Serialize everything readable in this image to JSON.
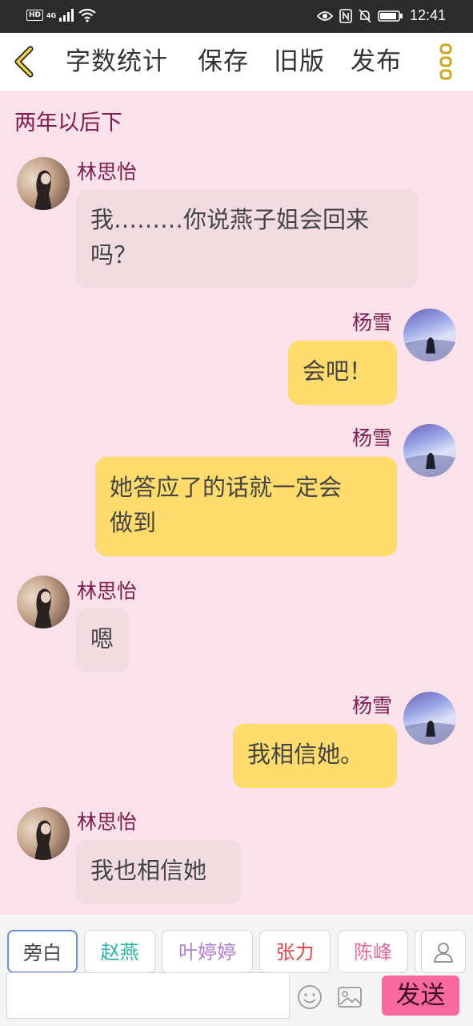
{
  "status_bar": {
    "network_badge": "HD",
    "network_type": "4G",
    "time": "12:41"
  },
  "nav": {
    "items": [
      "字数统计",
      "保存",
      "旧版",
      "发布"
    ]
  },
  "chat": {
    "narration": "两年以后下",
    "messages": [
      {
        "speaker": "林思怡",
        "side": "left",
        "text": "我………你说燕子姐会回来\n吗？"
      },
      {
        "speaker": "杨雪",
        "side": "right",
        "text": "会吧！"
      },
      {
        "speaker": "杨雪",
        "side": "right",
        "text": "她答应了的话就一定会\n做到"
      },
      {
        "speaker": "林思怡",
        "side": "left",
        "text": "嗯"
      },
      {
        "speaker": "杨雪",
        "side": "right",
        "text": "我相信她。"
      },
      {
        "speaker": "林思怡",
        "side": "left",
        "text": "我也相信她"
      }
    ]
  },
  "roles": [
    {
      "label": "旁白",
      "color": "#555555"
    },
    {
      "label": "赵燕",
      "color": "#2ab3a6"
    },
    {
      "label": "叶婷婷",
      "color": "#b57bd6"
    },
    {
      "label": "张力",
      "color": "#e0474a"
    },
    {
      "label": "陈峰",
      "color": "#e06d9a"
    }
  ],
  "composer": {
    "input_value": "",
    "send_label": "发送"
  },
  "colors": {
    "background": "#fae1ea",
    "name_color": "#7c1f4f",
    "left_bubble": "#f1dde1",
    "right_bubble": "#ffdc6c",
    "send_button": "#fb6a9f"
  }
}
